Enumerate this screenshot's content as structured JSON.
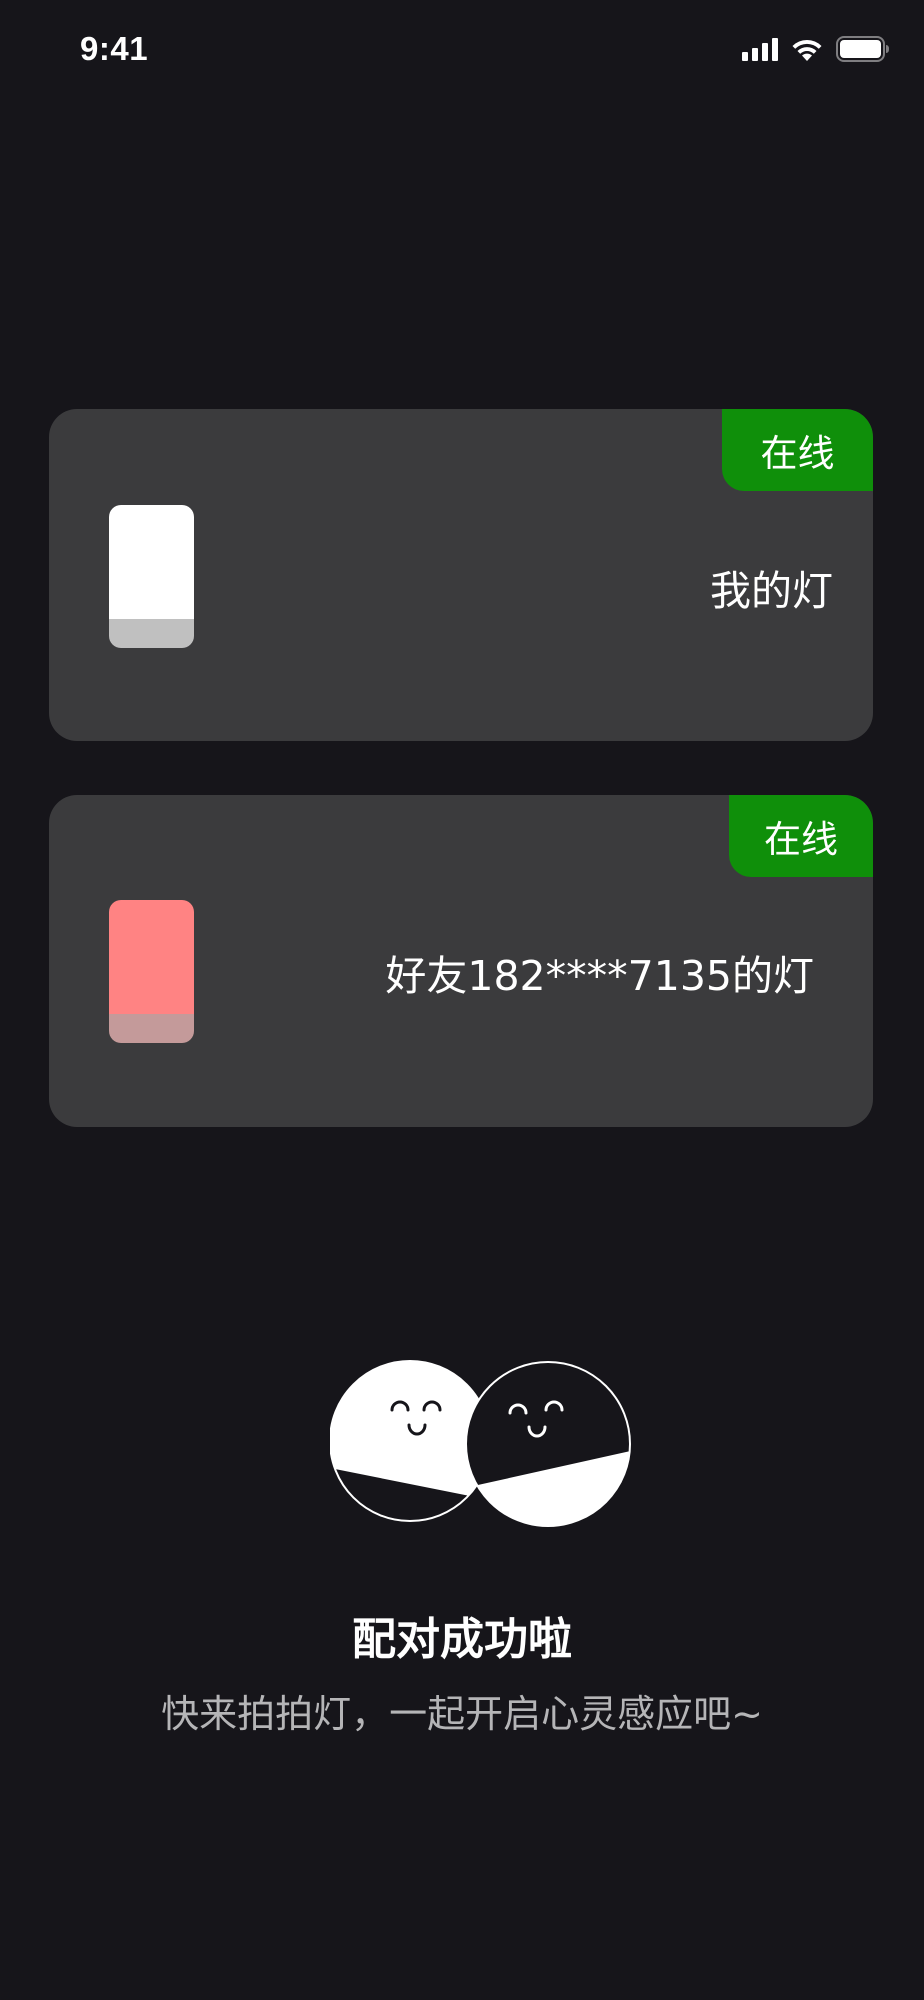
{
  "status_bar": {
    "time": "9:41",
    "icons": [
      "signal-icon",
      "wifi-icon",
      "battery-icon"
    ]
  },
  "devices": [
    {
      "status": "在线",
      "name": "我的灯",
      "icon": "lamp-icon",
      "lamp_color": "#ffffff"
    },
    {
      "status": "在线",
      "name": "好友182****7135的灯",
      "icon": "lamp-icon",
      "lamp_color": "#ff8383"
    }
  ],
  "colors": {
    "background": "#16151a",
    "card": "#3b3b3d",
    "online_badge": "#0f8f0a"
  },
  "success": {
    "illustration": "paired-faces-illustration",
    "title": "配对成功啦",
    "subtitle": "快来拍拍灯，一起开启心灵感应吧~"
  }
}
